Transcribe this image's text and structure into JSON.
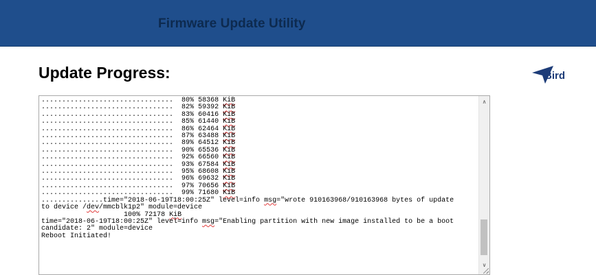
{
  "header": {
    "title": "Firmware Update Utility",
    "color": "#1f4e8c"
  },
  "page": {
    "heading": "Update Progress:"
  },
  "logo": {
    "text": "Bird",
    "icon": "bird-logo-icon",
    "color": "#1d3c78"
  },
  "console": {
    "progress_lines": [
      {
        "dots": "................................",
        "percent": "80%",
        "size": "58368",
        "unit": "KiB"
      },
      {
        "dots": "................................",
        "percent": "82%",
        "size": "59392",
        "unit": "KiB"
      },
      {
        "dots": "................................",
        "percent": "83%",
        "size": "60416",
        "unit": "KiB"
      },
      {
        "dots": "................................",
        "percent": "85%",
        "size": "61440",
        "unit": "KiB"
      },
      {
        "dots": "................................",
        "percent": "86%",
        "size": "62464",
        "unit": "KiB"
      },
      {
        "dots": "................................",
        "percent": "87%",
        "size": "63488",
        "unit": "KiB"
      },
      {
        "dots": "................................",
        "percent": "89%",
        "size": "64512",
        "unit": "KiB"
      },
      {
        "dots": "................................",
        "percent": "90%",
        "size": "65536",
        "unit": "KiB"
      },
      {
        "dots": "................................",
        "percent": "92%",
        "size": "66560",
        "unit": "KiB"
      },
      {
        "dots": "................................",
        "percent": "93%",
        "size": "67584",
        "unit": "KiB"
      },
      {
        "dots": "................................",
        "percent": "95%",
        "size": "68608",
        "unit": "KiB"
      },
      {
        "dots": "................................",
        "percent": "96%",
        "size": "69632",
        "unit": "KiB"
      },
      {
        "dots": "................................",
        "percent": "97%",
        "size": "70656",
        "unit": "KiB"
      },
      {
        "dots": "................................",
        "percent": "99%",
        "size": "71680",
        "unit": "KiB"
      }
    ],
    "wrote_line": {
      "prefix": "...............time=\"2018-06-19T18:00:25Z\" level=info ",
      "msg_key": "msg",
      "suffix": "=\"wrote 910163968/910163968 bytes of update"
    },
    "device_line": {
      "prefix": "to device /",
      "dev": "dev",
      "suffix": "/mmcblk1p2\" module=device"
    },
    "final_progress": {
      "indent": "                    ",
      "percent": "100%",
      "size": "72178",
      "unit": "KiB"
    },
    "enabling_line": {
      "prefix": "time=\"2018-06-19T18:00:25Z\" level=info ",
      "msg_key": "msg",
      "suffix": "=\"Enabling partition with new image installed to be a boot"
    },
    "candidate_line": "candidate: 2\" module=device",
    "reboot_line": "Reboot Initiated!"
  },
  "scrollbar": {
    "up_icon": "scroll-up-arrow-icon",
    "down_icon": "scroll-down-arrow-icon",
    "up_glyph": "∧",
    "down_glyph": "∨"
  }
}
